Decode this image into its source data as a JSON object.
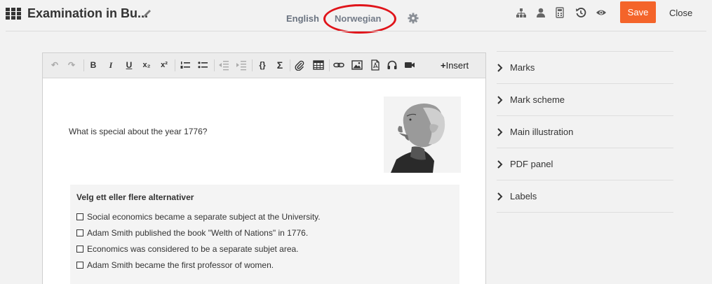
{
  "header": {
    "title": "Examination in Bu...",
    "languages": {
      "english": "English",
      "norwegian": "Norwegian"
    },
    "save_label": "Save",
    "close_label": "Close",
    "icons": [
      "grid-icon",
      "pencil-icon",
      "gear-icon",
      "sitemap-icon",
      "user-icon",
      "calculator-icon",
      "history-icon",
      "eye-icon"
    ],
    "accent_color": "#f4642a",
    "highlight_color": "#e0141a"
  },
  "editor": {
    "toolbar": {
      "insert_label": "Insert",
      "buttons": [
        "undo-icon",
        "redo-icon",
        "B",
        "I",
        "U",
        "x₂",
        "x²",
        "ordered-list-icon",
        "unordered-list-icon",
        "outdent-icon",
        "indent-icon",
        "{}",
        "Σ",
        "attachment-icon",
        "table-icon",
        "link-icon",
        "image-icon",
        "pdf-icon",
        "audio-icon",
        "video-icon"
      ]
    },
    "question_text": "What is special about the year 1776?",
    "answer": {
      "heading": "Velg ett eller flere alternativer",
      "options": [
        "Social economics became a separate subject at the University.",
        "Adam Smith published the book \"Welth of Nations\" in 1776.",
        "Economics was considered to be a separate subjet area.",
        "Adam Smith became the first professor of women."
      ]
    }
  },
  "side_panel": {
    "items": [
      "Marks",
      "Mark scheme",
      "Main illustration",
      "PDF panel",
      "Labels"
    ]
  }
}
